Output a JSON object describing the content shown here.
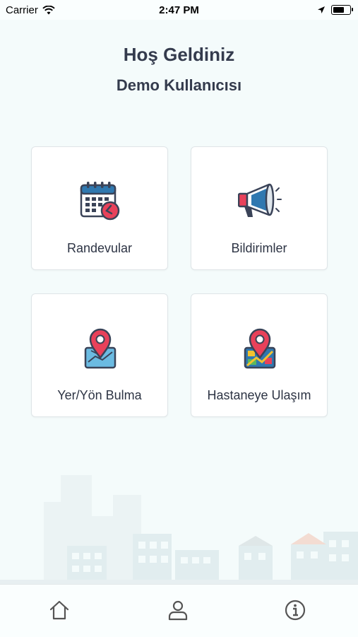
{
  "status_bar": {
    "carrier": "Carrier",
    "time": "2:47 PM",
    "battery_level": 0.7
  },
  "header": {
    "welcome": "Hoş Geldiniz",
    "user_name": "Demo Kullanıcısı"
  },
  "tiles": [
    {
      "label": "Randevular",
      "icon": "calendar-clock-icon"
    },
    {
      "label": "Bildirimler",
      "icon": "megaphone-icon"
    },
    {
      "label": "Yer/Yön Bulma",
      "icon": "map-pin-icon"
    },
    {
      "label": "Hastaneye Ulaşım",
      "icon": "map-route-icon"
    }
  ],
  "tab_bar": {
    "items": [
      {
        "icon": "home-icon"
      },
      {
        "icon": "user-icon"
      },
      {
        "icon": "info-icon"
      }
    ]
  },
  "colors": {
    "background": "#f4fbfb",
    "title": "#343b4d",
    "accent_red": "#e8415a",
    "icon_blue": "#2f78b0",
    "icon_dark": "#3a4358"
  }
}
